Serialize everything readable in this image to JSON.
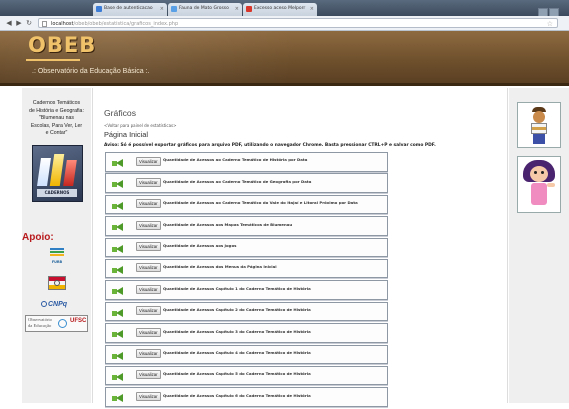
{
  "browser": {
    "tabs": [
      {
        "label": "Base de autenticacao",
        "color": "#3c7bd6"
      },
      {
        "label": "Fauna de Mato Grosso",
        "color": "#5aa0e6"
      },
      {
        "label": "Excesso aceso Melporr",
        "color": "#d8362a"
      }
    ],
    "url_host": "localhost",
    "url_path": "/obeb/obeb/estatistica/graficos_index.php"
  },
  "header": {
    "logo": "OBEB",
    "subtitle": ".: Observatório da Educação Básica :."
  },
  "sidebar": {
    "cadernos_lines": [
      "Cadernos Temáticos",
      "de História e Geografia:",
      "\"Blumenau nas",
      "Escolas, Para Ver, Ler",
      "e Contar\""
    ],
    "book_caption": "CADERNOS",
    "apoio_label": "Apoio:",
    "furb_label": "FURB",
    "cnpq_label": "CNPq",
    "observatorio_label_1": "Observatório",
    "observatorio_label_2": "da Educação",
    "ufsc_label": "UFSC"
  },
  "main": {
    "heading": "Gráficos",
    "back_link": "<Voltar para painel de estatísticas>",
    "title": "Página Inicial",
    "notice": "Aviso: Só é possível exportar gráficos para arquivo PDF, utilizando o navegador Chrome. Basta pressionar CTRL+P e salvar como PDF.",
    "button_label": "Visualizar",
    "reports": [
      "Quantidade de Acessos ao Caderno Temático de História por Data",
      "Quantidade de Acessos ao Caderno Temático de Geografia por Data",
      "Quantidade de Acessos ao Caderno Temático do Vale do Itajaí e Litoral Próximo por Data",
      "Quantidade de Acessos aos Mapas Temáticos de Blumenau",
      "Quantidade de Acessos aos Jogos",
      "Quantidade de Acessos dos Menus da Página Inicial",
      "Quantidade de Acessos Capítulo 1 do Caderno Temático de História",
      "Quantidade de Acessos Capítulo 2 do Caderno Temático de História",
      "Quantidade de Acessos Capítulo 3 do Caderno Temático de História",
      "Quantidade de Acessos Capítulo 4 do Caderno Temático de História",
      "Quantidade de Acessos Capítulo 5 do Caderno Temático de História",
      "Quantidade de Acessos Capítulo 6 do Caderno Temático de História"
    ]
  },
  "colors": {
    "header_brown": "#7a5632",
    "logo_gold": "#f0c36a",
    "apoio_red": "#b8191c",
    "icon_green": "#4e9a28"
  }
}
